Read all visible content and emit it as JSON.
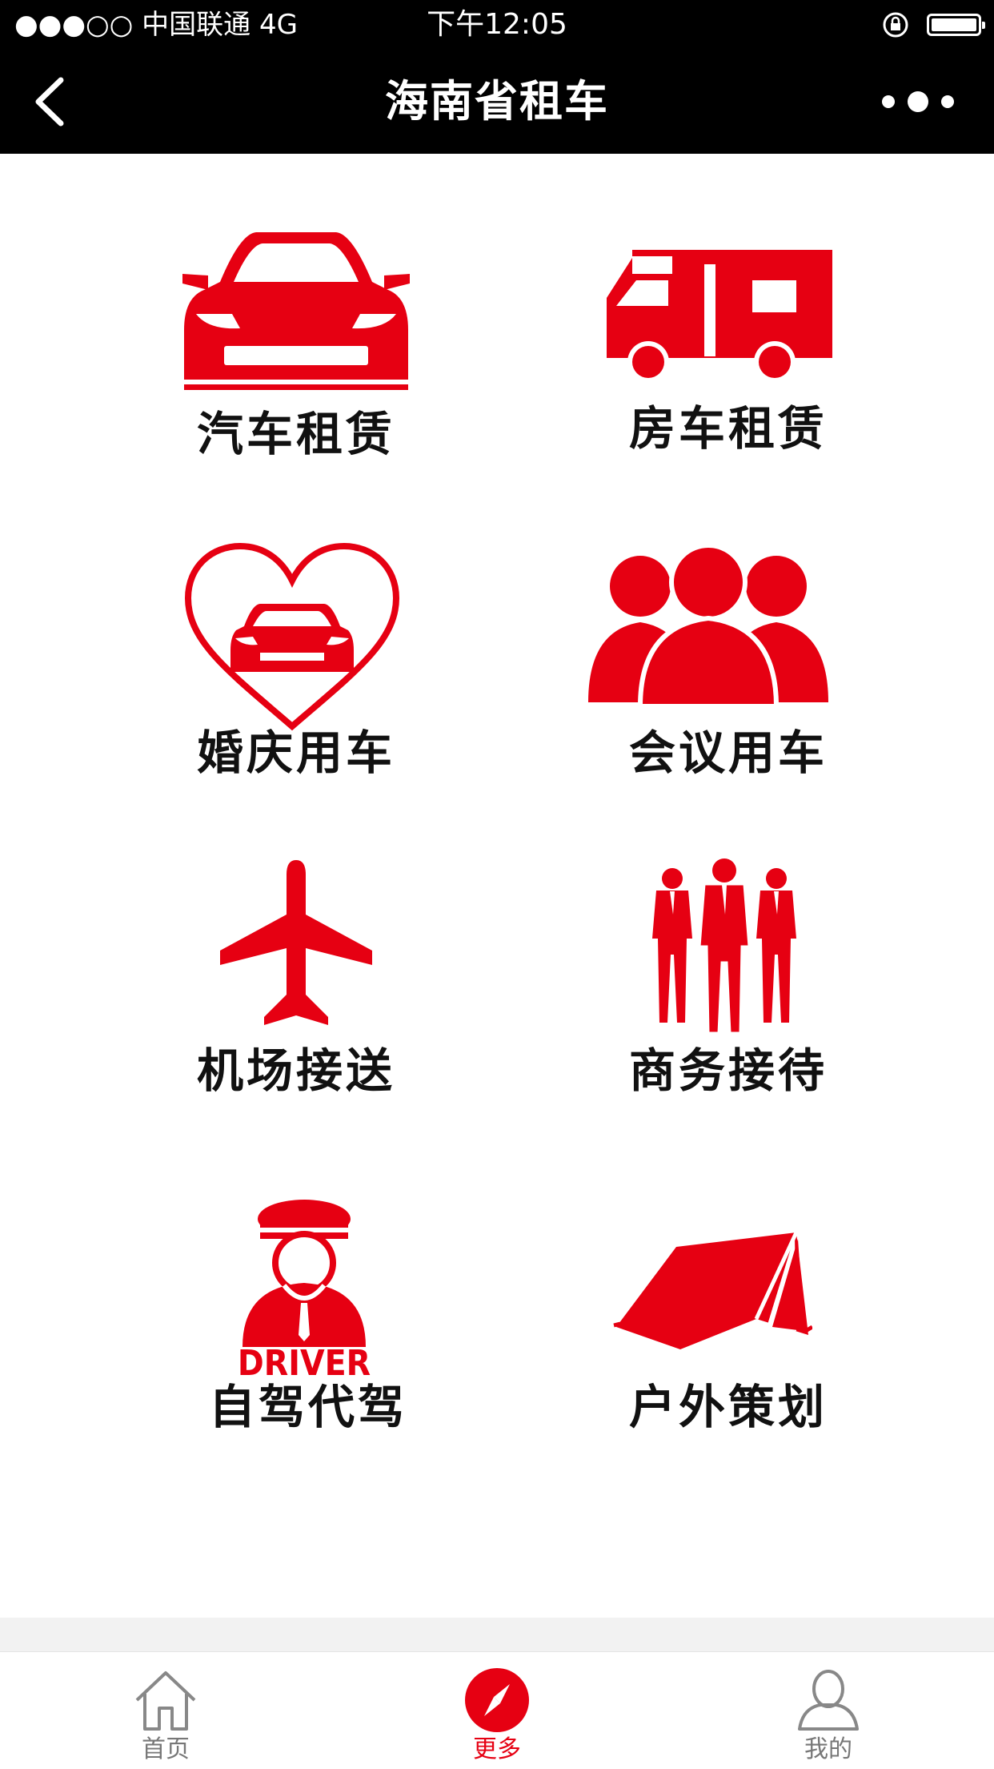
{
  "status_bar": {
    "carrier": "●●●○○ 中国联通   4G",
    "time": "下午12:05"
  },
  "nav": {
    "title": "海南省租车",
    "back_icon": "chevron-left-icon",
    "more_icon": "more-dots-icon"
  },
  "colors": {
    "accent": "#e60012",
    "bar": "#000000",
    "label": "#111111",
    "tab_inactive": "#777777"
  },
  "services": [
    {
      "label": "汽车租赁",
      "icon": "car-icon"
    },
    {
      "label": "房车租赁",
      "icon": "rv-camper-icon"
    },
    {
      "label": "婚庆用车",
      "icon": "heart-car-icon"
    },
    {
      "label": "会议用车",
      "icon": "meeting-people-icon"
    },
    {
      "label": "机场接送",
      "icon": "airplane-icon"
    },
    {
      "label": "商务接待",
      "icon": "business-men-icon"
    },
    {
      "label": "自驾代驾",
      "icon": "driver-icon",
      "icon_text": "DRIVER"
    },
    {
      "label": "户外策划",
      "icon": "tent-icon"
    }
  ],
  "tabbar": {
    "tabs": [
      {
        "label": "首页",
        "icon": "home-icon",
        "active": false
      },
      {
        "label": "更多",
        "icon": "compass-icon",
        "active": true
      },
      {
        "label": "我的",
        "icon": "user-icon",
        "active": false
      }
    ]
  }
}
